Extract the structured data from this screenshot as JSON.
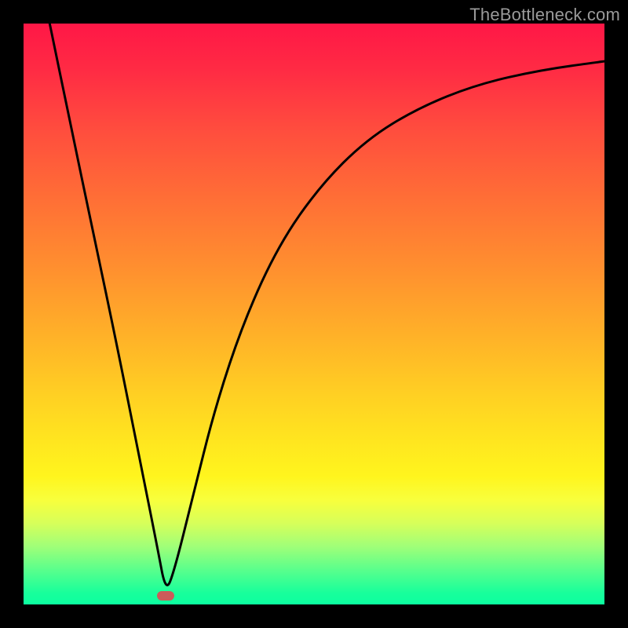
{
  "watermark": "TheBottleneck.com",
  "marker": {
    "color": "#cc5a5a",
    "x_frac": 0.245,
    "y_frac": 0.985
  },
  "chart_data": {
    "type": "line",
    "title": "",
    "xlabel": "",
    "ylabel": "",
    "xlim": [
      0,
      1
    ],
    "ylim": [
      0,
      1
    ],
    "legend": false,
    "grid": false,
    "background": "red-orange-yellow-green vertical gradient",
    "annotations": [
      {
        "kind": "marker",
        "shape": "pill",
        "x": 0.245,
        "y": 0.015,
        "color": "#cc5a5a"
      }
    ],
    "series": [
      {
        "name": "curve",
        "color": "#000000",
        "x": [
          0.045,
          0.08,
          0.12,
          0.16,
          0.2,
          0.23,
          0.245,
          0.26,
          0.29,
          0.33,
          0.38,
          0.44,
          0.51,
          0.59,
          0.68,
          0.78,
          0.89,
          1.0
        ],
        "y": [
          1.0,
          0.83,
          0.64,
          0.45,
          0.25,
          0.1,
          0.02,
          0.06,
          0.18,
          0.34,
          0.49,
          0.62,
          0.72,
          0.8,
          0.855,
          0.895,
          0.92,
          0.935
        ]
      }
    ]
  }
}
